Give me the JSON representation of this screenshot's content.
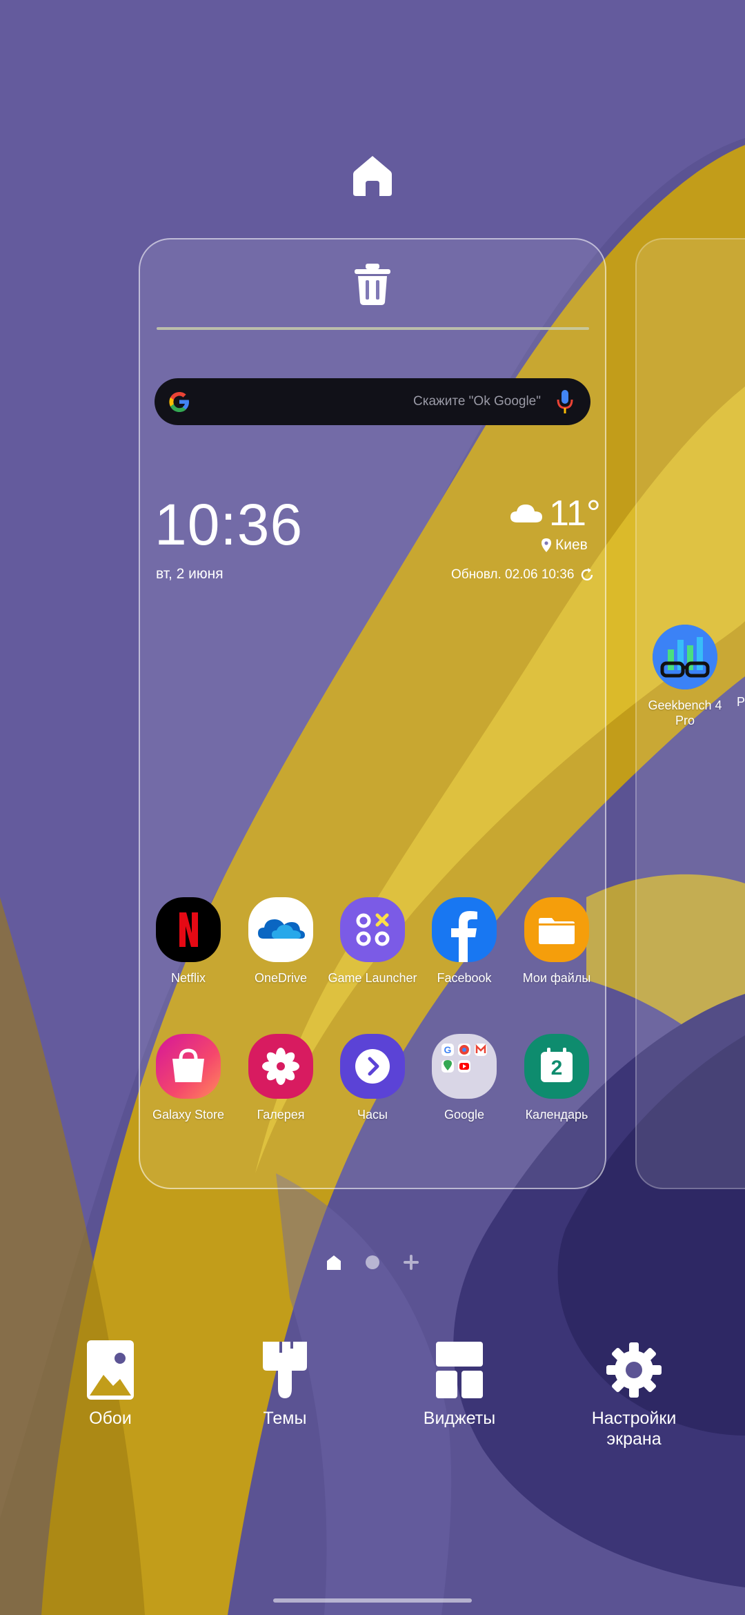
{
  "search": {
    "placeholder": "Скажите \"Ok Google\""
  },
  "clock": {
    "time": "10:36",
    "date": "вт, 2 июня"
  },
  "weather": {
    "temp": "11°",
    "city": "Киев",
    "updated": "Обновл. 02.06 10:36"
  },
  "apps_row1": [
    {
      "label": "Netflix"
    },
    {
      "label": "OneDrive"
    },
    {
      "label": "Game Launcher"
    },
    {
      "label": "Facebook"
    },
    {
      "label": "Мои файлы"
    }
  ],
  "apps_row2": [
    {
      "label": "Galaxy Store"
    },
    {
      "label": "Галерея"
    },
    {
      "label": "Часы"
    },
    {
      "label": "Google"
    },
    {
      "label": "Календарь",
      "day": "2"
    }
  ],
  "next_page": {
    "app_label_line1": "Geekbench 4",
    "app_label_line2": "Pro",
    "partial_label": "P"
  },
  "bottom_menu": {
    "wallpapers": "Обои",
    "themes": "Темы",
    "widgets": "Виджеты",
    "settings_line1": "Настройки",
    "settings_line2": "экрана"
  },
  "colors": {
    "background": "#5c5494",
    "accent_yellow": "#c9a218",
    "search_bg": "#111118"
  }
}
